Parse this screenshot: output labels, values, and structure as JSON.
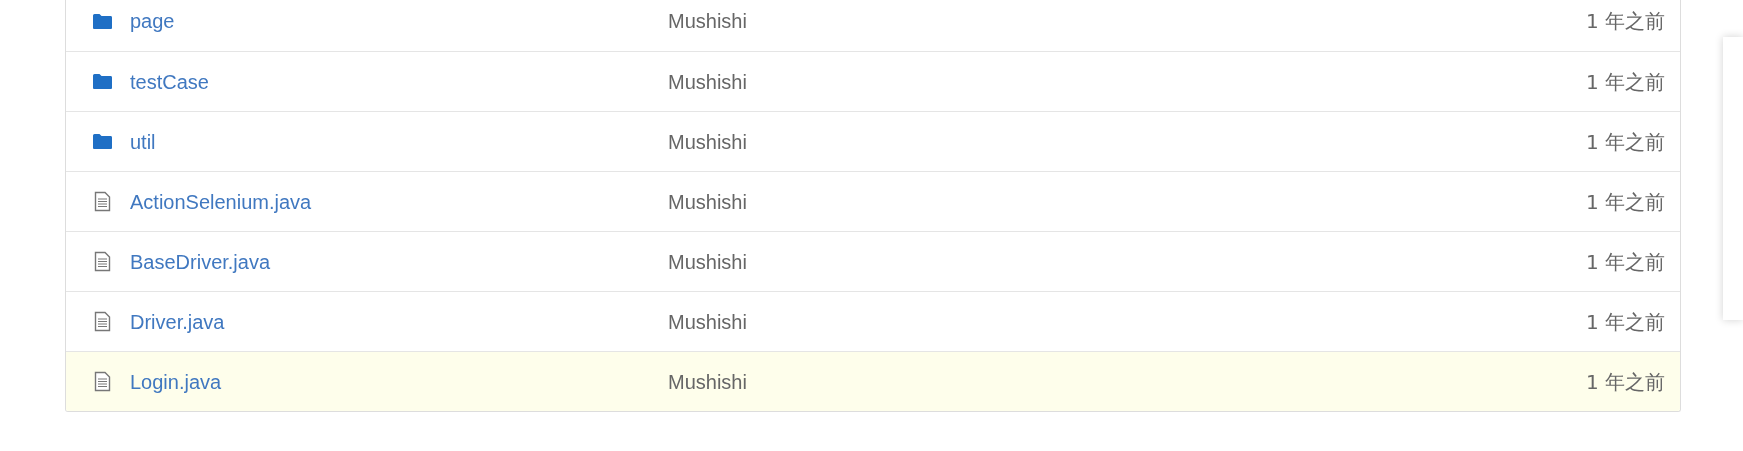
{
  "files": [
    {
      "kind": "folder",
      "name": "page",
      "author": "Mushishi",
      "time": "1 年之前",
      "highlighted": false
    },
    {
      "kind": "folder",
      "name": "testCase",
      "author": "Mushishi",
      "time": "1 年之前",
      "highlighted": false
    },
    {
      "kind": "folder",
      "name": "util",
      "author": "Mushishi",
      "time": "1 年之前",
      "highlighted": false
    },
    {
      "kind": "file",
      "name": "ActionSelenium.java",
      "author": "Mushishi",
      "time": "1 年之前",
      "highlighted": false
    },
    {
      "kind": "file",
      "name": "BaseDriver.java",
      "author": "Mushishi",
      "time": "1 年之前",
      "highlighted": false
    },
    {
      "kind": "file",
      "name": "Driver.java",
      "author": "Mushishi",
      "time": "1 年之前",
      "highlighted": false
    },
    {
      "kind": "file",
      "name": "Login.java",
      "author": "Mushishi",
      "time": "1 年之前",
      "highlighted": true
    }
  ]
}
